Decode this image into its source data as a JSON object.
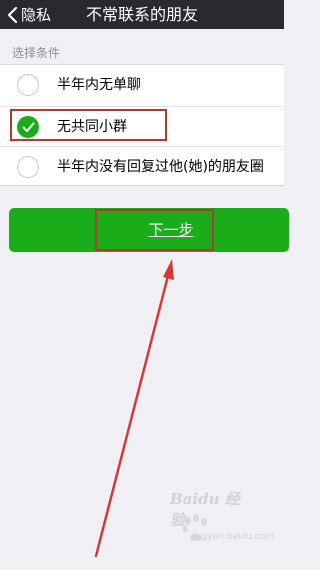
{
  "nav": {
    "back_label": "隐私",
    "title": "不常联系的朋友"
  },
  "section_header": "选择条件",
  "options": [
    {
      "label": "半年内无单聊",
      "checked": false
    },
    {
      "label": "无共同小群",
      "checked": true
    },
    {
      "label": "半年内没有回复过他(她)的朋友圈",
      "checked": false
    }
  ],
  "next_button": {
    "label": "下一步"
  },
  "watermark": {
    "text": "Baidu 经验",
    "sub": "jingyan.baidu.com"
  },
  "colors": {
    "nav_bg": "#2a2a2e",
    "accent_green": "#1aad19",
    "annotation_red": "#b03a2e",
    "page_bg": "#efeff4"
  }
}
